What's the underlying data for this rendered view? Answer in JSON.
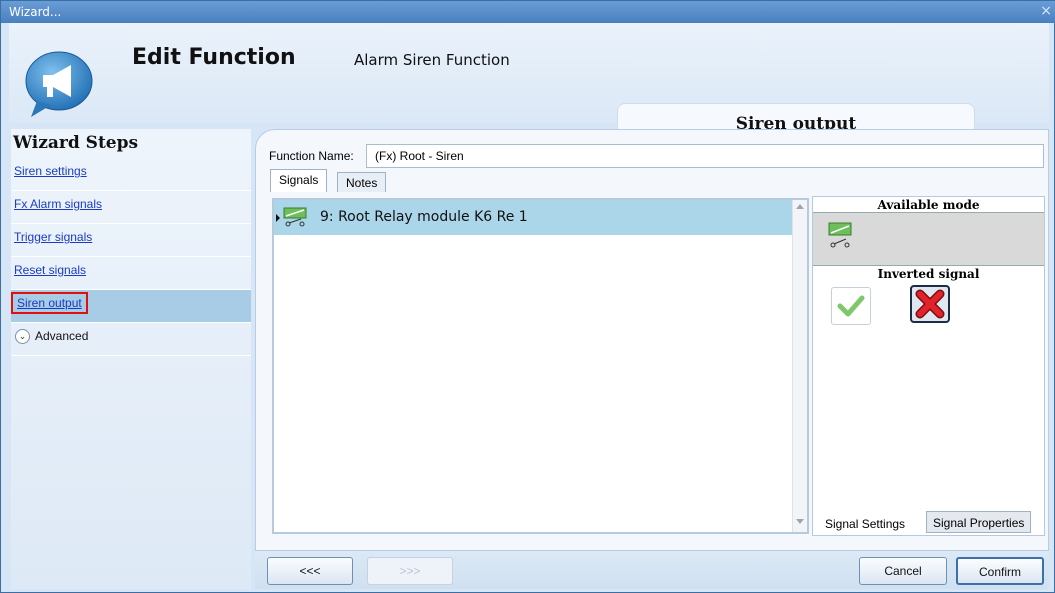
{
  "window": {
    "title": "Wizard...",
    "close_glyph": "×"
  },
  "header": {
    "title": "Edit Function",
    "subtitle": "Alarm Siren Function",
    "step_tab": "Siren output",
    "logo_icon": "megaphone-speech-bubble-icon"
  },
  "sidebar": {
    "title": "Wizard Steps",
    "items": [
      {
        "label": "Siren settings"
      },
      {
        "label": "Fx Alarm signals"
      },
      {
        "label": "Trigger signals"
      },
      {
        "label": "Reset signals"
      },
      {
        "label": "Siren output",
        "active": true
      },
      {
        "label": "Advanced",
        "expander": true
      }
    ]
  },
  "form": {
    "function_name_label": "Function Name:",
    "function_name_value": "(Fx) Root - Siren"
  },
  "tabs": {
    "signals": "Signals",
    "notes": "Notes"
  },
  "signals_list": {
    "rows": [
      {
        "label": "9: Root Relay module K6 Re 1",
        "icon": "relay-icon"
      }
    ]
  },
  "right_panel": {
    "available_mode": "Available mode",
    "inverted_signal": "Inverted signal",
    "tab_settings": "Signal Settings",
    "tab_properties": "Signal Properties"
  },
  "footer": {
    "back": "<<<",
    "next": ">>>",
    "cancel": "Cancel",
    "confirm": "Confirm"
  },
  "colors": {
    "active_step_bg": "#a8cbe6",
    "highlight_red": "#e01010",
    "selected_row_bg": "#abd6ea",
    "link_blue": "#1a3cc4"
  }
}
